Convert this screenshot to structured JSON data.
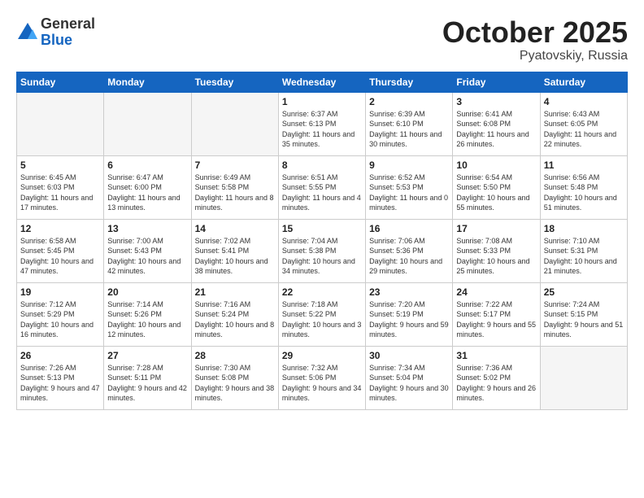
{
  "header": {
    "logo_general": "General",
    "logo_blue": "Blue",
    "month": "October 2025",
    "location": "Pyatovskiy, Russia"
  },
  "days_of_week": [
    "Sunday",
    "Monday",
    "Tuesday",
    "Wednesday",
    "Thursday",
    "Friday",
    "Saturday"
  ],
  "weeks": [
    [
      {
        "day": "",
        "info": ""
      },
      {
        "day": "",
        "info": ""
      },
      {
        "day": "",
        "info": ""
      },
      {
        "day": "1",
        "info": "Sunrise: 6:37 AM\nSunset: 6:13 PM\nDaylight: 11 hours\nand 35 minutes."
      },
      {
        "day": "2",
        "info": "Sunrise: 6:39 AM\nSunset: 6:10 PM\nDaylight: 11 hours\nand 30 minutes."
      },
      {
        "day": "3",
        "info": "Sunrise: 6:41 AM\nSunset: 6:08 PM\nDaylight: 11 hours\nand 26 minutes."
      },
      {
        "day": "4",
        "info": "Sunrise: 6:43 AM\nSunset: 6:05 PM\nDaylight: 11 hours\nand 22 minutes."
      }
    ],
    [
      {
        "day": "5",
        "info": "Sunrise: 6:45 AM\nSunset: 6:03 PM\nDaylight: 11 hours\nand 17 minutes."
      },
      {
        "day": "6",
        "info": "Sunrise: 6:47 AM\nSunset: 6:00 PM\nDaylight: 11 hours\nand 13 minutes."
      },
      {
        "day": "7",
        "info": "Sunrise: 6:49 AM\nSunset: 5:58 PM\nDaylight: 11 hours\nand 8 minutes."
      },
      {
        "day": "8",
        "info": "Sunrise: 6:51 AM\nSunset: 5:55 PM\nDaylight: 11 hours\nand 4 minutes."
      },
      {
        "day": "9",
        "info": "Sunrise: 6:52 AM\nSunset: 5:53 PM\nDaylight: 11 hours\nand 0 minutes."
      },
      {
        "day": "10",
        "info": "Sunrise: 6:54 AM\nSunset: 5:50 PM\nDaylight: 10 hours\nand 55 minutes."
      },
      {
        "day": "11",
        "info": "Sunrise: 6:56 AM\nSunset: 5:48 PM\nDaylight: 10 hours\nand 51 minutes."
      }
    ],
    [
      {
        "day": "12",
        "info": "Sunrise: 6:58 AM\nSunset: 5:45 PM\nDaylight: 10 hours\nand 47 minutes."
      },
      {
        "day": "13",
        "info": "Sunrise: 7:00 AM\nSunset: 5:43 PM\nDaylight: 10 hours\nand 42 minutes."
      },
      {
        "day": "14",
        "info": "Sunrise: 7:02 AM\nSunset: 5:41 PM\nDaylight: 10 hours\nand 38 minutes."
      },
      {
        "day": "15",
        "info": "Sunrise: 7:04 AM\nSunset: 5:38 PM\nDaylight: 10 hours\nand 34 minutes."
      },
      {
        "day": "16",
        "info": "Sunrise: 7:06 AM\nSunset: 5:36 PM\nDaylight: 10 hours\nand 29 minutes."
      },
      {
        "day": "17",
        "info": "Sunrise: 7:08 AM\nSunset: 5:33 PM\nDaylight: 10 hours\nand 25 minutes."
      },
      {
        "day": "18",
        "info": "Sunrise: 7:10 AM\nSunset: 5:31 PM\nDaylight: 10 hours\nand 21 minutes."
      }
    ],
    [
      {
        "day": "19",
        "info": "Sunrise: 7:12 AM\nSunset: 5:29 PM\nDaylight: 10 hours\nand 16 minutes."
      },
      {
        "day": "20",
        "info": "Sunrise: 7:14 AM\nSunset: 5:26 PM\nDaylight: 10 hours\nand 12 minutes."
      },
      {
        "day": "21",
        "info": "Sunrise: 7:16 AM\nSunset: 5:24 PM\nDaylight: 10 hours\nand 8 minutes."
      },
      {
        "day": "22",
        "info": "Sunrise: 7:18 AM\nSunset: 5:22 PM\nDaylight: 10 hours\nand 3 minutes."
      },
      {
        "day": "23",
        "info": "Sunrise: 7:20 AM\nSunset: 5:19 PM\nDaylight: 9 hours\nand 59 minutes."
      },
      {
        "day": "24",
        "info": "Sunrise: 7:22 AM\nSunset: 5:17 PM\nDaylight: 9 hours\nand 55 minutes."
      },
      {
        "day": "25",
        "info": "Sunrise: 7:24 AM\nSunset: 5:15 PM\nDaylight: 9 hours\nand 51 minutes."
      }
    ],
    [
      {
        "day": "26",
        "info": "Sunrise: 7:26 AM\nSunset: 5:13 PM\nDaylight: 9 hours\nand 47 minutes."
      },
      {
        "day": "27",
        "info": "Sunrise: 7:28 AM\nSunset: 5:11 PM\nDaylight: 9 hours\nand 42 minutes."
      },
      {
        "day": "28",
        "info": "Sunrise: 7:30 AM\nSunset: 5:08 PM\nDaylight: 9 hours\nand 38 minutes."
      },
      {
        "day": "29",
        "info": "Sunrise: 7:32 AM\nSunset: 5:06 PM\nDaylight: 9 hours\nand 34 minutes."
      },
      {
        "day": "30",
        "info": "Sunrise: 7:34 AM\nSunset: 5:04 PM\nDaylight: 9 hours\nand 30 minutes."
      },
      {
        "day": "31",
        "info": "Sunrise: 7:36 AM\nSunset: 5:02 PM\nDaylight: 9 hours\nand 26 minutes."
      },
      {
        "day": "",
        "info": ""
      }
    ]
  ]
}
